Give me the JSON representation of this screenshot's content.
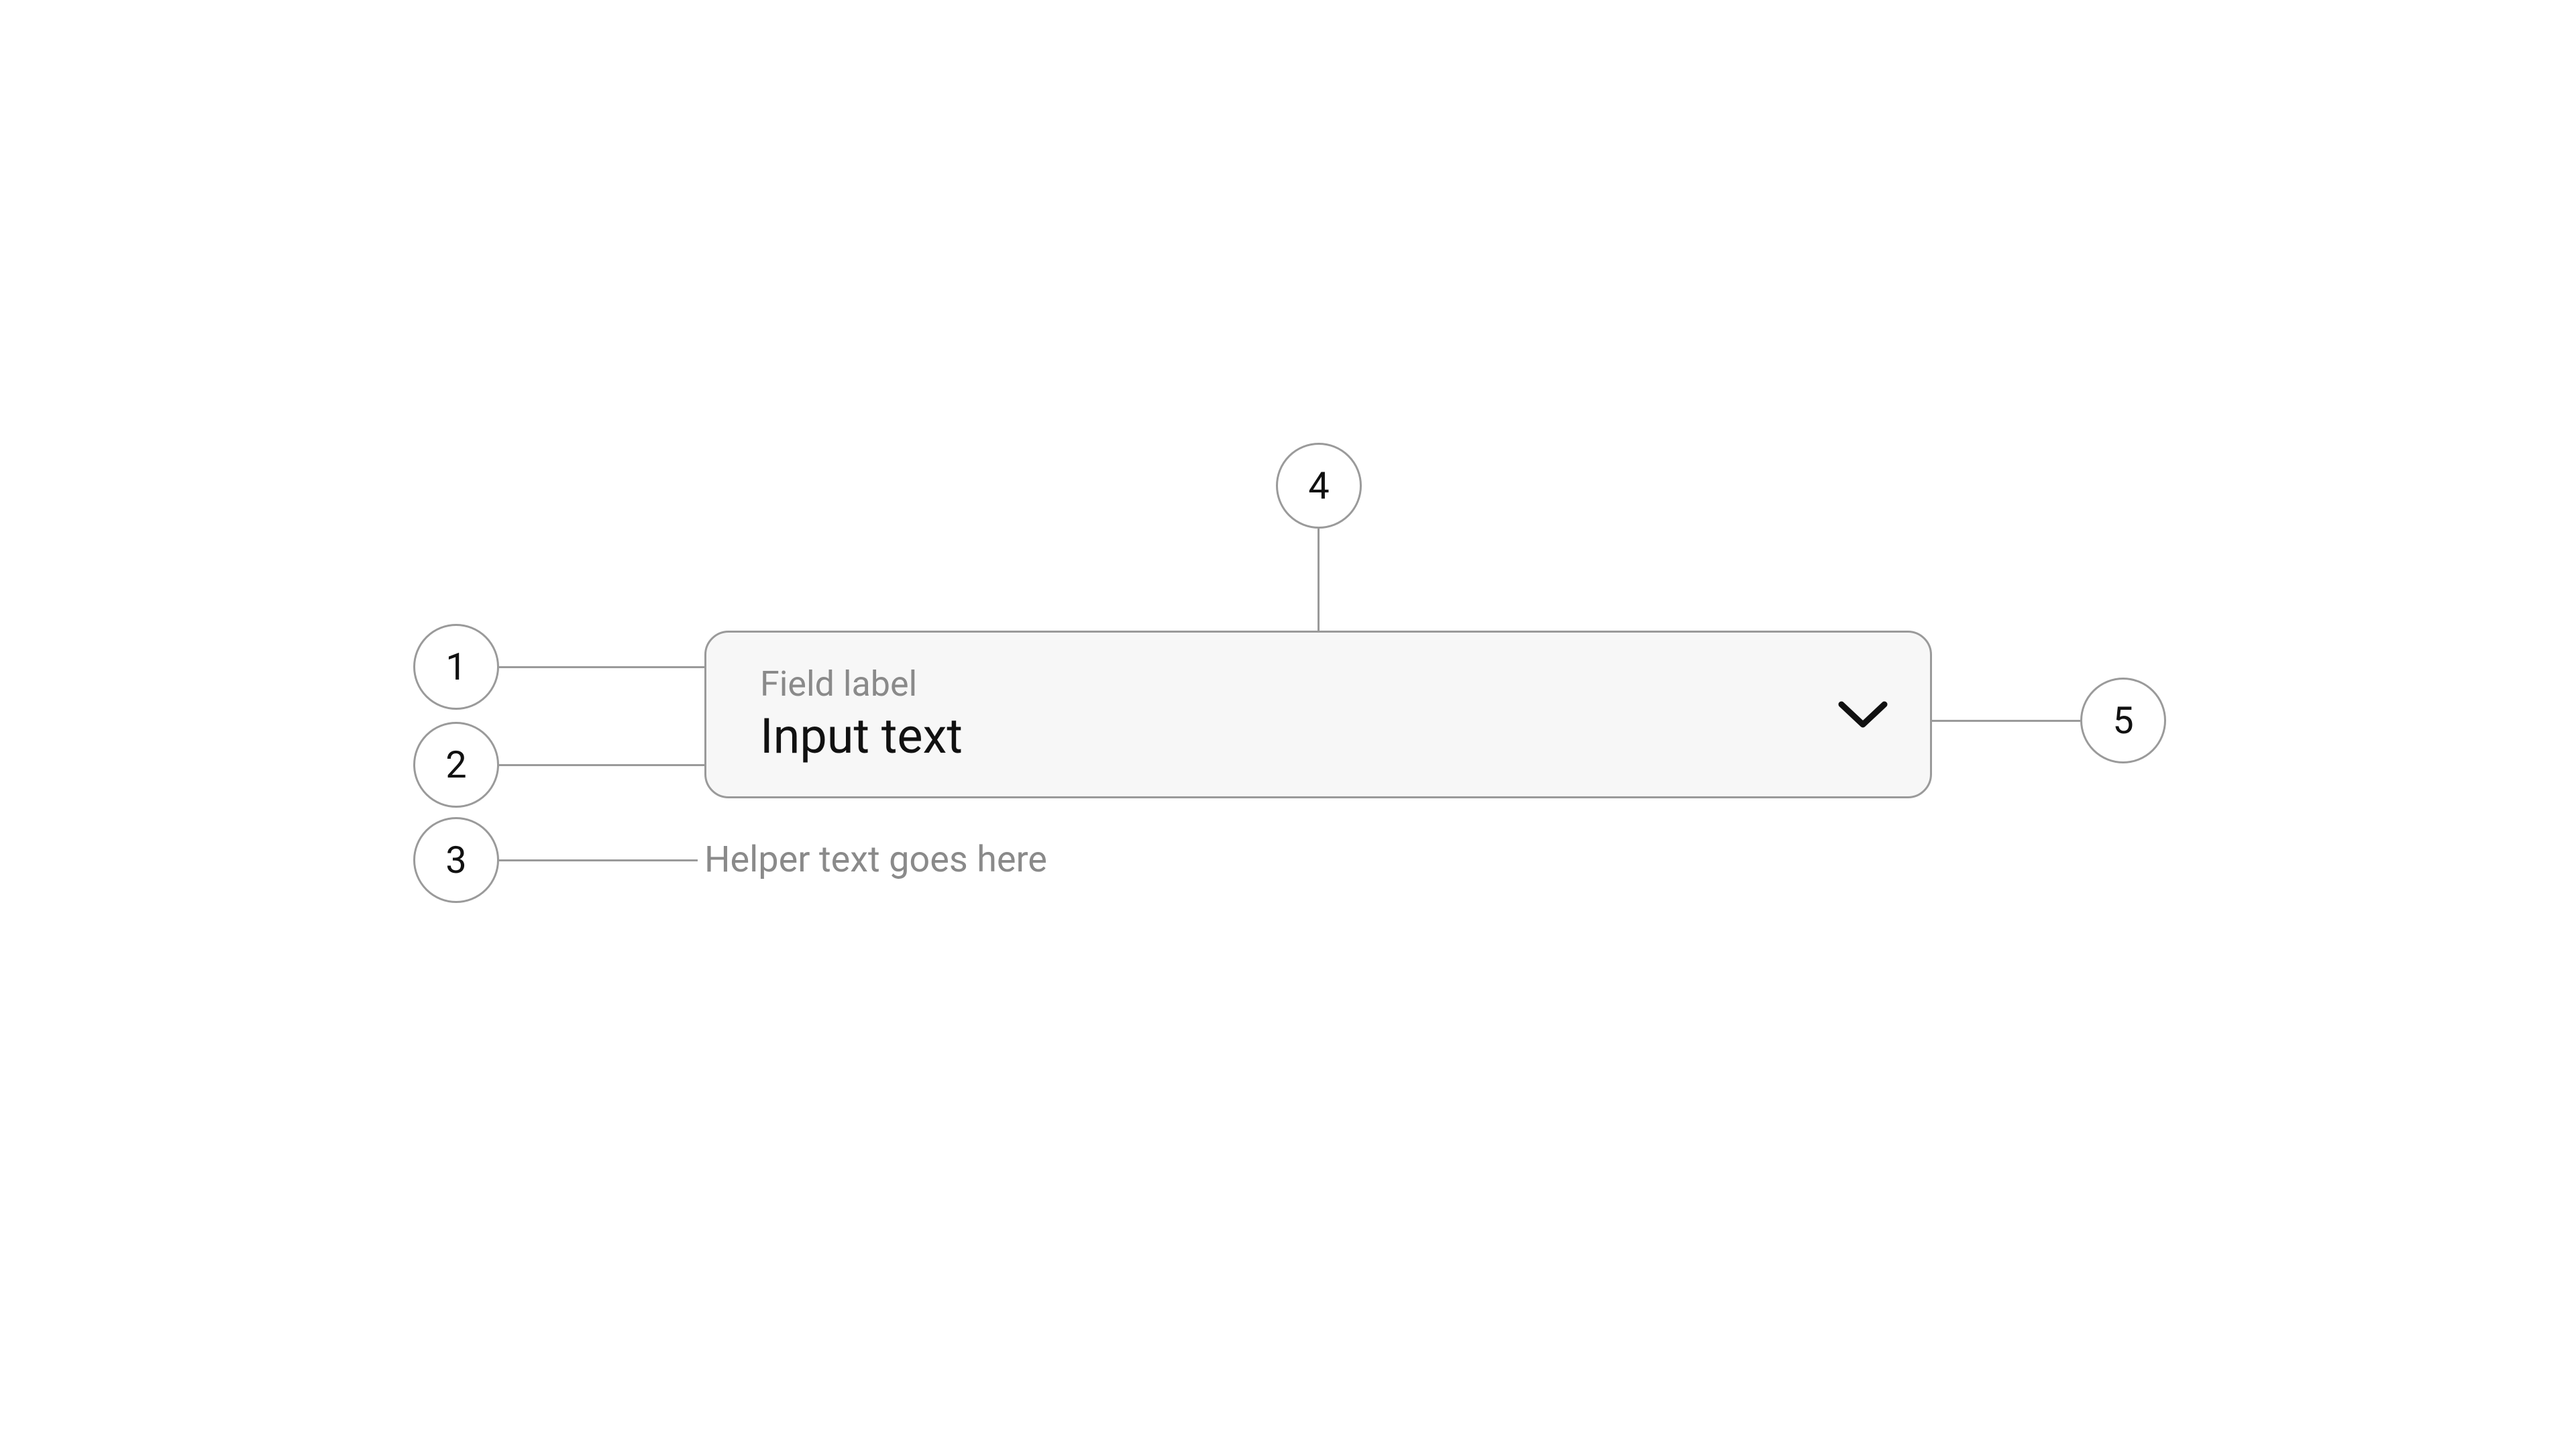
{
  "dropdown": {
    "field_label": "Field label",
    "input_text": "Input text",
    "helper_text": "Helper text goes here"
  },
  "annotations": {
    "a1": "1",
    "a2": "2",
    "a3": "3",
    "a4": "4",
    "a5": "5"
  }
}
